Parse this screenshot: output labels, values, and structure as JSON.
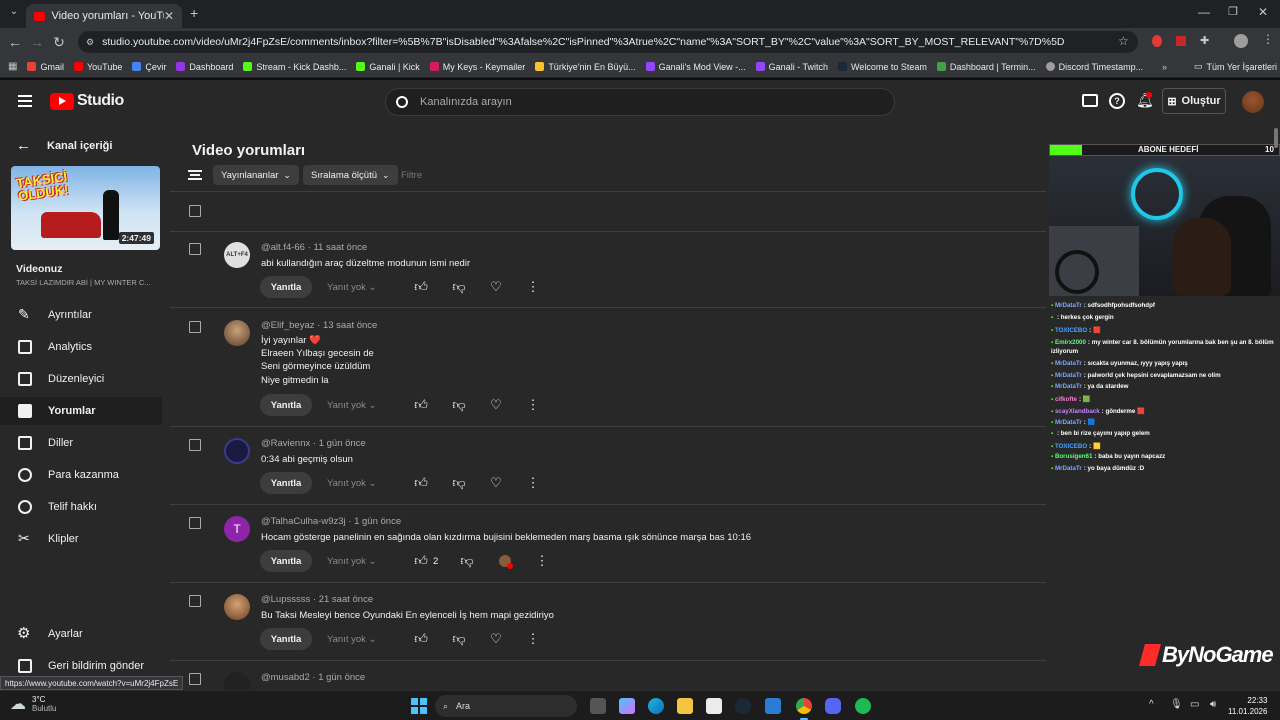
{
  "browser": {
    "tab_title": "Video yorumları - YouTube Studio",
    "url": "studio.youtube.com/video/uMr2j4FpZsE/comments/inbox?filter=%5B%7B\"isDisabled\"%3Afalse%2C\"isPinned\"%3Atrue%2C\"name\"%3A\"SORT_BY\"%2C\"value\"%3A\"SORT_BY_MOST_RELEVANT\"%7D%5D",
    "bookmarks": [
      "Gmail",
      "YouTube",
      "Çevir",
      "Dashboard",
      "Stream - Kick Dashb...",
      "Ganali | Kick",
      "My Keys - Keymailer",
      "Türkiye'nin En Büyü...",
      "Ganali's Mod View -...",
      "Ganali - Twitch",
      "Welcome to Steam",
      "Dashboard | Termin...",
      "Discord Timestamp..."
    ],
    "bookmarks_right": "Tüm Yer İşaretleri",
    "status_url": "https://www.youtube.com/watch?v=uMr2j4FpZsE"
  },
  "header": {
    "logo_text": "Studio",
    "search_placeholder": "Kanalınızda arayın",
    "create_label": "Oluştur"
  },
  "sidebar": {
    "back_label": "Kanal içeriği",
    "video_duration": "2:47:49",
    "video_section_title": "Videonuz",
    "video_title": "TAKSİ LAZIMDIR ABİ | MY WINTER C...",
    "thumbnail_text": "TAKSİCİ OLDUK!",
    "items": [
      {
        "label": "Ayrıntılar",
        "icon": "pencil-icon"
      },
      {
        "label": "Analytics",
        "icon": "analytics-icon"
      },
      {
        "label": "Düzenleyici",
        "icon": "editor-icon"
      },
      {
        "label": "Yorumlar",
        "icon": "comments-icon",
        "active": true
      },
      {
        "label": "Diller",
        "icon": "subtitles-icon"
      },
      {
        "label": "Para kazanma",
        "icon": "dollar-icon"
      },
      {
        "label": "Telif hakkı",
        "icon": "copyright-icon"
      },
      {
        "label": "Klipler",
        "icon": "scissors-icon"
      }
    ],
    "bottom_items": [
      {
        "label": "Ayarlar",
        "icon": "gear-icon"
      },
      {
        "label": "Geri bildirim gönder",
        "icon": "feedback-icon"
      }
    ]
  },
  "main": {
    "title": "Video yorumları",
    "filter_chip": "Yayınlananlar",
    "sort_chip": "Sıralama ölçütü",
    "filter_placeholder": "Filtre",
    "reply_label": "Yanıtla",
    "noreply_label": "Yanıt yok",
    "comments": [
      {
        "author": "@alt.f4-66",
        "time": "11 saat önce",
        "lines": [
          "abi kullandığın araç düzeltme modunun ismi nedir"
        ],
        "likes": ""
      },
      {
        "author": "@Elif_beyaz",
        "time": "13 saat önce",
        "lines": [
          "İyi yayınlar ❤️",
          "Elraeen Yılbaşı gecesin de",
          "Seni görmeyince üzüldüm",
          "Niye gitmedin la"
        ],
        "likes": ""
      },
      {
        "author": "@Raviennx",
        "time": "1 gün önce",
        "lines": [
          "0:34 abi geçmiş olsun"
        ],
        "likes": ""
      },
      {
        "author": "@TalhaCulha-w9z3j",
        "time": "1 gün önce",
        "lines": [
          "Hocam gösterge panelinin en sağında olan kızdırma bujisini beklemeden marş basma ışık sönünce marşa bas 10:16"
        ],
        "likes": "2",
        "avatar_letter": "T"
      },
      {
        "author": "@Lupsssss",
        "time": "21 saat önce",
        "lines": [
          "Bu Taksi Mesleyi bence Oyundaki En eylenceli İş hem mapi gezidiriyo"
        ],
        "likes": ""
      },
      {
        "author": "@musabd2",
        "time": "1 gün önce",
        "lines": [],
        "likes": ""
      }
    ]
  },
  "overlay": {
    "goal_label": "ABONE HEDEFİ",
    "goal_value": "10",
    "chat": [
      {
        "user": "MrDataTr",
        "msg": "sdfsodhfpohsdfsohdpf",
        "color": "#7aa7ff"
      },
      {
        "user": "",
        "msg": "herkes çok gergin",
        "color": "#ff5252"
      },
      {
        "user": "TOXICEBO",
        "msg": "🟥",
        "color": "#4aa3ff"
      },
      {
        "user": "Emirx2000",
        "msg": "my winter car 8. bölümün yorumlarına bak ben şu an 8. bölüm izliyorum",
        "color": "#59ff7a"
      },
      {
        "user": "MrDataTr",
        "msg": "sıcakta uyunmaz, ıyyy yapış yapış",
        "color": "#7aa7ff"
      },
      {
        "user": "MrDataTr",
        "msg": "palworld çek hepsini cevaplamazsam ne olim",
        "color": "#7aa7ff"
      },
      {
        "user": "MrDataTr",
        "msg": "ya da stardew",
        "color": "#7aa7ff"
      },
      {
        "user": "cifkofte",
        "msg": "🟩",
        "color": "#ff7ad9"
      },
      {
        "user": "scayXlandback",
        "msg": "gönderme 🟥",
        "color": "#c583ff"
      },
      {
        "user": "MrDataTr",
        "msg": "🟦",
        "color": "#7aa7ff"
      },
      {
        "user": "",
        "msg": "ben bi rize çayımı yapıp gelem",
        "color": "#ff5252"
      },
      {
        "user": "TOXICEBO",
        "msg": "🟨",
        "color": "#4aa3ff"
      },
      {
        "user": "Borusigen61",
        "msg": "baba bu yayın napcazz",
        "color": "#59ff7a"
      },
      {
        "user": "MrDataTr",
        "msg": "yo baya dümdüz :D",
        "color": "#7aa7ff"
      }
    ],
    "brand": "ByNoGame"
  },
  "taskbar": {
    "weather_temp": "3°C",
    "weather_desc": "Bulutlu",
    "search_label": "Ara",
    "time": "22:33",
    "date": "11.01.2026"
  }
}
